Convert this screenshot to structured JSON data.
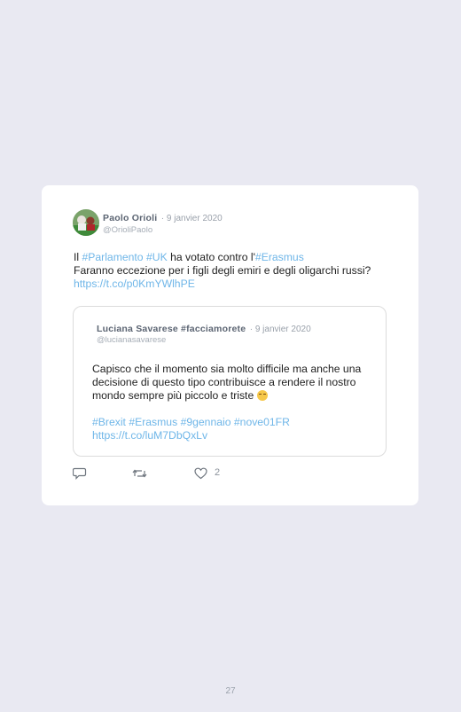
{
  "tweet": {
    "author_name": "Paolo Orioli",
    "date": "· 9 janvier 2020",
    "handle": "@OrioliPaolo",
    "line1_prefix": "Il ",
    "tag_parlamento": "#Parlamento",
    "tag_uk": "#UK",
    "line1_mid": " ha votato contro l'",
    "tag_erasmus": "#Erasmus",
    "line2": "Faranno eccezione per i figli degli emiri e degli oligarchi russi? ",
    "link": "https://t.co/p0KmYWlhPE"
  },
  "quoted": {
    "author_name": "Luciana Savarese #facciamorete",
    "date": "· 9 janvier 2020",
    "handle": "@lucianasavarese",
    "text": "Capisco che il momento sia molto difficile ma anche una decisione di questo tipo contribuisce a rendere il nostro mondo sempre più piccolo e triste",
    "emoji": "relieved-face",
    "hashtags": "#Brexit #Erasmus #9gennaio #nove01FR",
    "link": "https://t.co/luM7DbQxLv"
  },
  "actions": {
    "reply_icon": "reply-icon",
    "retweet_icon": "retweet-icon",
    "like_icon": "heart-icon",
    "like_count": "2"
  },
  "page": {
    "number": "27"
  },
  "colors": {
    "link": "#6fb6e8",
    "background": "#e9e9f2",
    "card": "#ffffff"
  }
}
